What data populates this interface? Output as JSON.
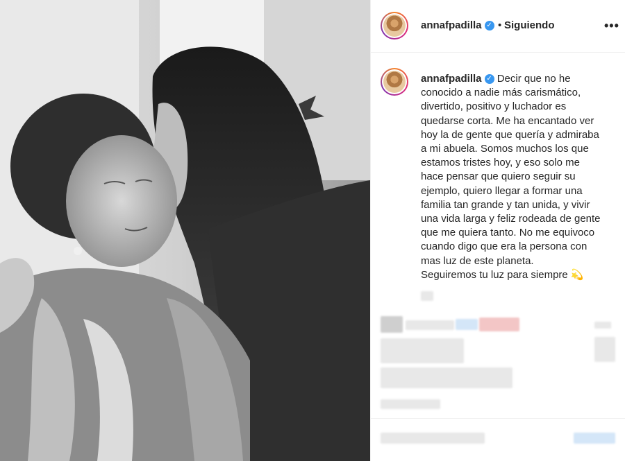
{
  "post": {
    "username": "annafpadilla",
    "separator": "•",
    "follow_status": "Siguiendo",
    "more_label": "•••",
    "verified_mark": "✓"
  },
  "caption": {
    "username": "annafpadilla",
    "lines": [
      "Decir que no he",
      "conocido a nadie más carismático,",
      "divertido, positivo y luchador es",
      "quedarse corta. Me ha encantado ver",
      "hoy la de gente que quería y admiraba",
      "a mi abuela. Somos muchos los que",
      "estamos tristes hoy, y eso solo me",
      "hace pensar que quiero seguir su",
      "ejemplo, quiero llegar a formar una",
      "familia tan grande y tan unida, y vivir",
      "una vida larga y feliz rodeada de gente",
      "que me quiera tanto. No me equivoco",
      "cuando digo que era la persona con",
      "mas luz de este planeta.",
      "Seguiremos tu luz para siempre 💫"
    ]
  },
  "photo": {
    "description_icon": "photo-image"
  }
}
